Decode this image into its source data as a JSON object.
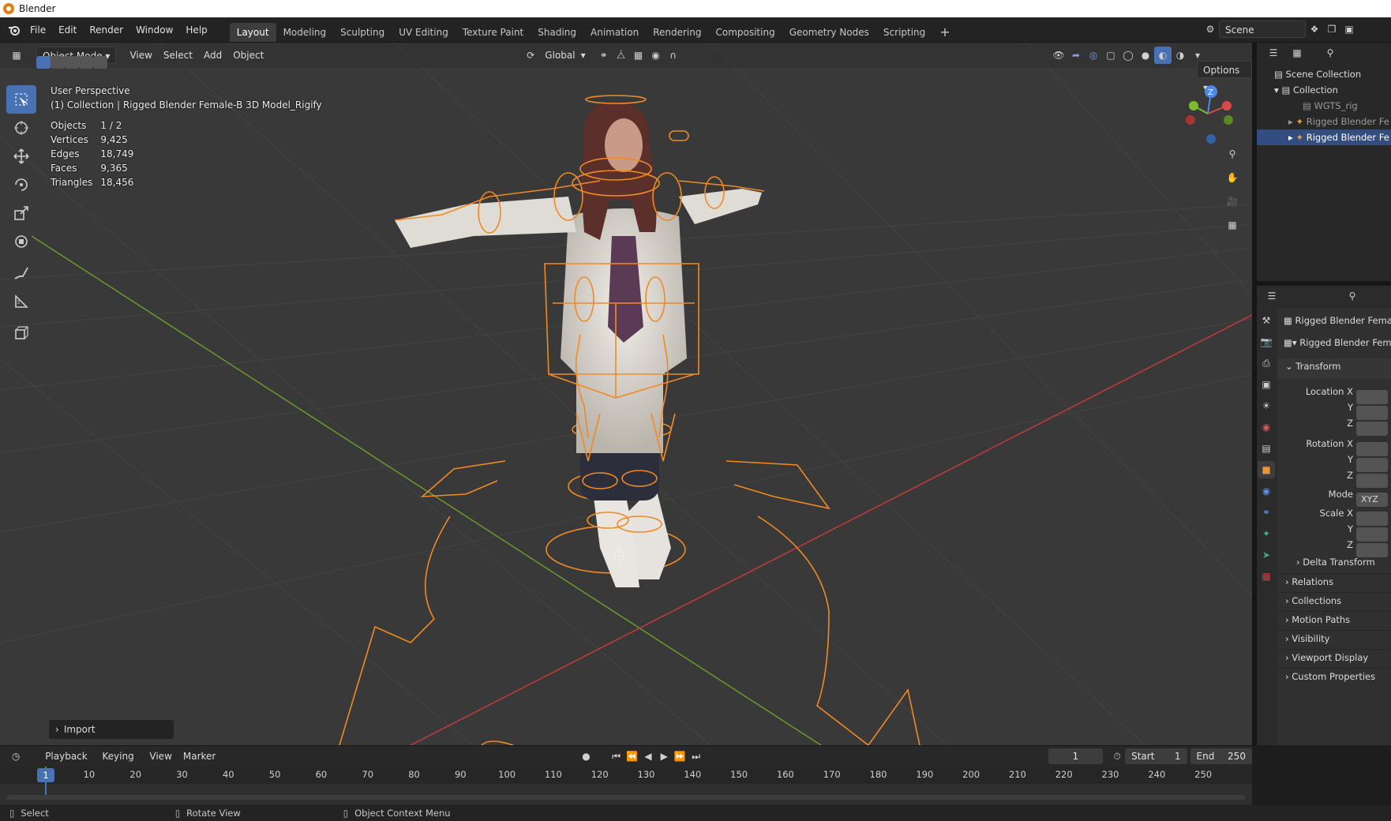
{
  "app": {
    "title": "Blender"
  },
  "menu": [
    "File",
    "Edit",
    "Render",
    "Window",
    "Help"
  ],
  "workspaces": [
    "Layout",
    "Modeling",
    "Sculpting",
    "UV Editing",
    "Texture Paint",
    "Shading",
    "Animation",
    "Rendering",
    "Compositing",
    "Geometry Nodes",
    "Scripting"
  ],
  "scene": {
    "name": "Scene"
  },
  "viewport": {
    "mode": "Object Mode",
    "menus": [
      "View",
      "Select",
      "Add",
      "Object"
    ],
    "orientation": "Global",
    "options_label": "Options",
    "view_name": "User Perspective",
    "collection_info": "(1) Collection | Rigged Blender Female-B 3D Model_Rigify",
    "stats": [
      {
        "label": "Objects",
        "value": "1 / 2"
      },
      {
        "label": "Vertices",
        "value": "9,425"
      },
      {
        "label": "Edges",
        "value": "18,749"
      },
      {
        "label": "Faces",
        "value": "9,365"
      },
      {
        "label": "Triangles",
        "value": "18,456"
      }
    ],
    "import_panel": "Import",
    "gizmo": {
      "z": "Z"
    }
  },
  "outliner": {
    "items": [
      {
        "label": "Scene Collection"
      },
      {
        "label": "Collection"
      },
      {
        "label": "WGTS_rig"
      },
      {
        "label": "Rigged Blender Fe"
      },
      {
        "label": "Rigged Blender Fe"
      }
    ]
  },
  "properties": {
    "object_name": "Rigged Blender Female",
    "data_name": "Rigged Blender Fem",
    "transform_header": "Transform",
    "location_x": "Location X",
    "rotation_x": "Rotation X",
    "y": "Y",
    "z": "Z",
    "mode_label": "Mode",
    "mode_value": "XYZ",
    "scale_x": "Scale X",
    "delta": "Delta Transform",
    "sections": [
      "Relations",
      "Collections",
      "Motion Paths",
      "Visibility",
      "Viewport Display",
      "Custom Properties"
    ]
  },
  "timeline": {
    "menus": [
      "Playback",
      "Keying",
      "View",
      "Marker"
    ],
    "current_frame": "1",
    "start_label": "Start",
    "start_value": "1",
    "end_label": "End",
    "end_value": "250",
    "ticks": [
      "1",
      "10",
      "20",
      "30",
      "40",
      "50",
      "60",
      "70",
      "80",
      "90",
      "100",
      "110",
      "120",
      "130",
      "140",
      "150",
      "160",
      "170",
      "180",
      "190",
      "200",
      "210",
      "220",
      "230",
      "240",
      "250"
    ]
  },
  "statusbar": {
    "select": "Select",
    "rotate": "Rotate View",
    "context": "Object Context Menu"
  },
  "colors": {
    "accent": "#4772b3",
    "armature": "#f08a24",
    "x_axis": "#c43a3a",
    "y_axis": "#6a9a2a"
  }
}
